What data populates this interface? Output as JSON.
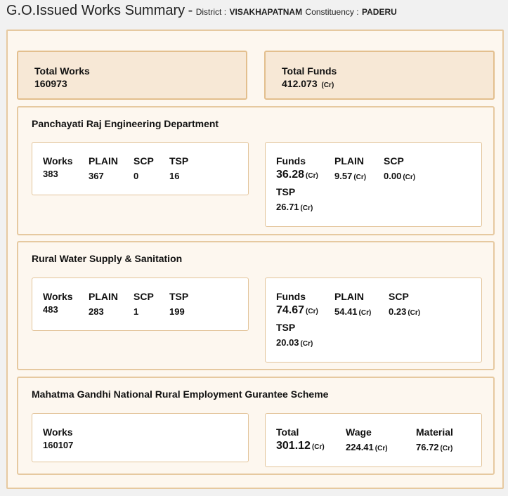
{
  "header": {
    "title": "G.O.Issued Works Summary",
    "separator": "-",
    "district_label": "District :",
    "district": "VISAKHAPATNAM",
    "constituency_label": "Constituency :",
    "constituency": "PADERU"
  },
  "summary": {
    "total_works_label": "Total Works",
    "total_works": "160973",
    "total_funds_label": "Total Funds",
    "total_funds": "412.073",
    "unit": "(Cr)"
  },
  "departments": [
    {
      "name": "Panchayati Raj Engineering Department",
      "works": {
        "works_label": "Works",
        "works": "383",
        "plain_label": "PLAIN",
        "plain": "367",
        "scp_label": "SCP",
        "scp": "0",
        "tsp_label": "TSP",
        "tsp": "16"
      },
      "funds": {
        "funds_label": "Funds",
        "funds": "36.28",
        "plain_label": "PLAIN",
        "plain": "9.57",
        "scp_label": "SCP",
        "scp": "0.00",
        "tsp_label": "TSP",
        "tsp": "26.71",
        "unit": "(Cr)"
      }
    },
    {
      "name": "Rural Water Supply & Sanitation",
      "works": {
        "works_label": "Works",
        "works": "483",
        "plain_label": "PLAIN",
        "plain": "283",
        "scp_label": "SCP",
        "scp": "1",
        "tsp_label": "TSP",
        "tsp": "199"
      },
      "funds": {
        "funds_label": "Funds",
        "funds": "74.67",
        "plain_label": "PLAIN",
        "plain": "54.41",
        "scp_label": "SCP",
        "scp": "0.23",
        "tsp_label": "TSP",
        "tsp": "20.03",
        "unit": "(Cr)"
      }
    },
    {
      "name": "Mahatma Gandhi National Rural Employment Gurantee Scheme",
      "works": {
        "works_label": "Works",
        "works": "160107"
      },
      "funds": {
        "total_label": "Total",
        "total": "301.12",
        "wage_label": "Wage",
        "wage": "224.41",
        "material_label": "Material",
        "material": "76.72",
        "unit": "(Cr)"
      }
    }
  ]
}
